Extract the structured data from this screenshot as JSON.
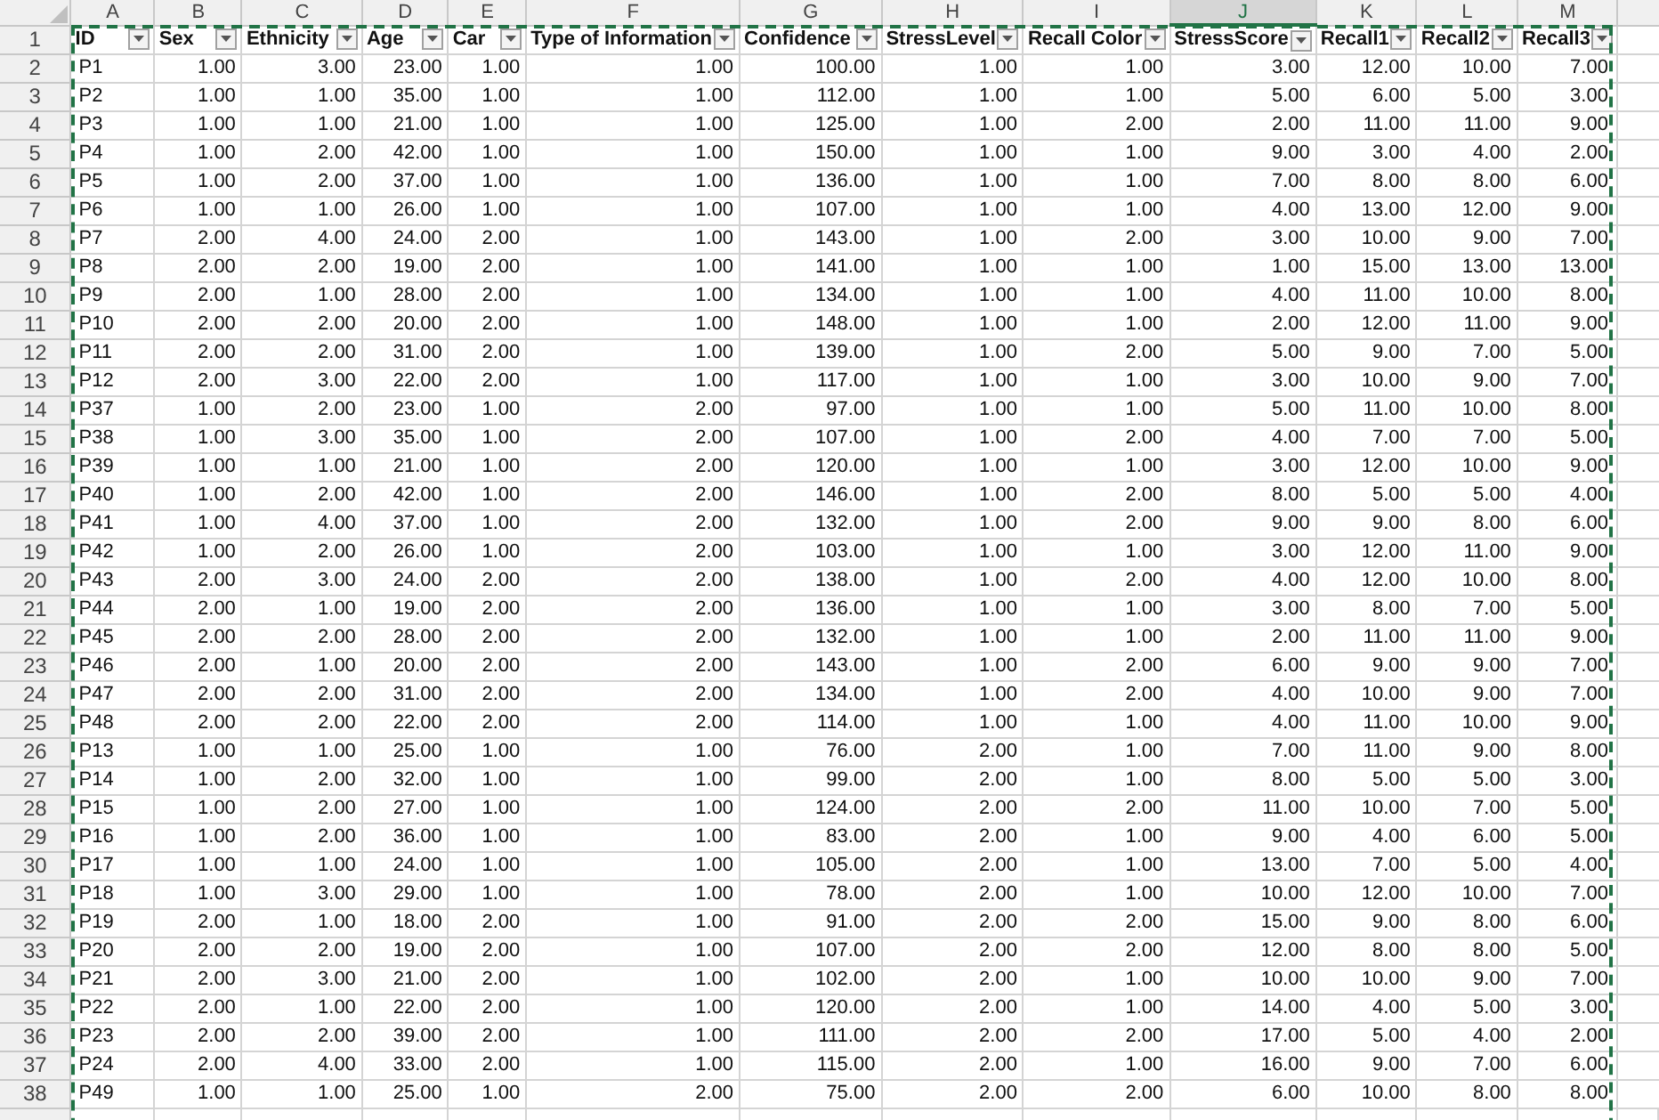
{
  "column_letters": [
    {
      "label": "A",
      "selected": false
    },
    {
      "label": "B",
      "selected": false
    },
    {
      "label": "C",
      "selected": false
    },
    {
      "label": "D",
      "selected": false
    },
    {
      "label": "E",
      "selected": false
    },
    {
      "label": "F",
      "selected": false
    },
    {
      "label": "G",
      "selected": false
    },
    {
      "label": "H",
      "selected": false
    },
    {
      "label": "I",
      "selected": false
    },
    {
      "label": "J",
      "selected": true
    },
    {
      "label": "K",
      "selected": false
    },
    {
      "label": "L",
      "selected": false
    },
    {
      "label": "M",
      "selected": false
    }
  ],
  "table": {
    "header_row_number": "1",
    "columns": [
      "ID",
      "Sex",
      "Ethnicity",
      "Age",
      "Car",
      "Type of Information",
      "Confidence",
      "StressLevel",
      "Recall Color",
      "StressScore",
      "Recall1",
      "Recall2",
      "Recall3"
    ],
    "rows": [
      {
        "row_number": "2",
        "cells": [
          "P1",
          "1.00",
          "3.00",
          "23.00",
          "1.00",
          "1.00",
          "100.00",
          "1.00",
          "1.00",
          "3.00",
          "12.00",
          "10.00",
          "7.00"
        ]
      },
      {
        "row_number": "3",
        "cells": [
          "P2",
          "1.00",
          "1.00",
          "35.00",
          "1.00",
          "1.00",
          "112.00",
          "1.00",
          "1.00",
          "5.00",
          "6.00",
          "5.00",
          "3.00"
        ]
      },
      {
        "row_number": "4",
        "cells": [
          "P3",
          "1.00",
          "1.00",
          "21.00",
          "1.00",
          "1.00",
          "125.00",
          "1.00",
          "2.00",
          "2.00",
          "11.00",
          "11.00",
          "9.00"
        ]
      },
      {
        "row_number": "5",
        "cells": [
          "P4",
          "1.00",
          "2.00",
          "42.00",
          "1.00",
          "1.00",
          "150.00",
          "1.00",
          "1.00",
          "9.00",
          "3.00",
          "4.00",
          "2.00"
        ]
      },
      {
        "row_number": "6",
        "cells": [
          "P5",
          "1.00",
          "2.00",
          "37.00",
          "1.00",
          "1.00",
          "136.00",
          "1.00",
          "1.00",
          "7.00",
          "8.00",
          "8.00",
          "6.00"
        ]
      },
      {
        "row_number": "7",
        "cells": [
          "P6",
          "1.00",
          "1.00",
          "26.00",
          "1.00",
          "1.00",
          "107.00",
          "1.00",
          "1.00",
          "4.00",
          "13.00",
          "12.00",
          "9.00"
        ]
      },
      {
        "row_number": "8",
        "cells": [
          "P7",
          "2.00",
          "4.00",
          "24.00",
          "2.00",
          "1.00",
          "143.00",
          "1.00",
          "2.00",
          "3.00",
          "10.00",
          "9.00",
          "7.00"
        ]
      },
      {
        "row_number": "9",
        "cells": [
          "P8",
          "2.00",
          "2.00",
          "19.00",
          "2.00",
          "1.00",
          "141.00",
          "1.00",
          "1.00",
          "1.00",
          "15.00",
          "13.00",
          "13.00"
        ]
      },
      {
        "row_number": "10",
        "cells": [
          "P9",
          "2.00",
          "1.00",
          "28.00",
          "2.00",
          "1.00",
          "134.00",
          "1.00",
          "1.00",
          "4.00",
          "11.00",
          "10.00",
          "8.00"
        ]
      },
      {
        "row_number": "11",
        "cells": [
          "P10",
          "2.00",
          "2.00",
          "20.00",
          "2.00",
          "1.00",
          "148.00",
          "1.00",
          "1.00",
          "2.00",
          "12.00",
          "11.00",
          "9.00"
        ]
      },
      {
        "row_number": "12",
        "cells": [
          "P11",
          "2.00",
          "2.00",
          "31.00",
          "2.00",
          "1.00",
          "139.00",
          "1.00",
          "2.00",
          "5.00",
          "9.00",
          "7.00",
          "5.00"
        ]
      },
      {
        "row_number": "13",
        "cells": [
          "P12",
          "2.00",
          "3.00",
          "22.00",
          "2.00",
          "1.00",
          "117.00",
          "1.00",
          "1.00",
          "3.00",
          "10.00",
          "9.00",
          "7.00"
        ]
      },
      {
        "row_number": "14",
        "cells": [
          "P37",
          "1.00",
          "2.00",
          "23.00",
          "1.00",
          "2.00",
          "97.00",
          "1.00",
          "1.00",
          "5.00",
          "11.00",
          "10.00",
          "8.00"
        ]
      },
      {
        "row_number": "15",
        "cells": [
          "P38",
          "1.00",
          "3.00",
          "35.00",
          "1.00",
          "2.00",
          "107.00",
          "1.00",
          "2.00",
          "4.00",
          "7.00",
          "7.00",
          "5.00"
        ]
      },
      {
        "row_number": "16",
        "cells": [
          "P39",
          "1.00",
          "1.00",
          "21.00",
          "1.00",
          "2.00",
          "120.00",
          "1.00",
          "1.00",
          "3.00",
          "12.00",
          "10.00",
          "9.00"
        ]
      },
      {
        "row_number": "17",
        "cells": [
          "P40",
          "1.00",
          "2.00",
          "42.00",
          "1.00",
          "2.00",
          "146.00",
          "1.00",
          "2.00",
          "8.00",
          "5.00",
          "5.00",
          "4.00"
        ]
      },
      {
        "row_number": "18",
        "cells": [
          "P41",
          "1.00",
          "4.00",
          "37.00",
          "1.00",
          "2.00",
          "132.00",
          "1.00",
          "2.00",
          "9.00",
          "9.00",
          "8.00",
          "6.00"
        ]
      },
      {
        "row_number": "19",
        "cells": [
          "P42",
          "1.00",
          "2.00",
          "26.00",
          "1.00",
          "2.00",
          "103.00",
          "1.00",
          "1.00",
          "3.00",
          "12.00",
          "11.00",
          "9.00"
        ]
      },
      {
        "row_number": "20",
        "cells": [
          "P43",
          "2.00",
          "3.00",
          "24.00",
          "2.00",
          "2.00",
          "138.00",
          "1.00",
          "2.00",
          "4.00",
          "12.00",
          "10.00",
          "8.00"
        ]
      },
      {
        "row_number": "21",
        "cells": [
          "P44",
          "2.00",
          "1.00",
          "19.00",
          "2.00",
          "2.00",
          "136.00",
          "1.00",
          "1.00",
          "3.00",
          "8.00",
          "7.00",
          "5.00"
        ]
      },
      {
        "row_number": "22",
        "cells": [
          "P45",
          "2.00",
          "2.00",
          "28.00",
          "2.00",
          "2.00",
          "132.00",
          "1.00",
          "1.00",
          "2.00",
          "11.00",
          "11.00",
          "9.00"
        ]
      },
      {
        "row_number": "23",
        "cells": [
          "P46",
          "2.00",
          "1.00",
          "20.00",
          "2.00",
          "2.00",
          "143.00",
          "1.00",
          "2.00",
          "6.00",
          "9.00",
          "9.00",
          "7.00"
        ]
      },
      {
        "row_number": "24",
        "cells": [
          "P47",
          "2.00",
          "2.00",
          "31.00",
          "2.00",
          "2.00",
          "134.00",
          "1.00",
          "2.00",
          "4.00",
          "10.00",
          "9.00",
          "7.00"
        ]
      },
      {
        "row_number": "25",
        "cells": [
          "P48",
          "2.00",
          "2.00",
          "22.00",
          "2.00",
          "2.00",
          "114.00",
          "1.00",
          "1.00",
          "4.00",
          "11.00",
          "10.00",
          "9.00"
        ]
      },
      {
        "row_number": "26",
        "cells": [
          "P13",
          "1.00",
          "1.00",
          "25.00",
          "1.00",
          "1.00",
          "76.00",
          "2.00",
          "1.00",
          "7.00",
          "11.00",
          "9.00",
          "8.00"
        ]
      },
      {
        "row_number": "27",
        "cells": [
          "P14",
          "1.00",
          "2.00",
          "32.00",
          "1.00",
          "1.00",
          "99.00",
          "2.00",
          "1.00",
          "8.00",
          "5.00",
          "5.00",
          "3.00"
        ]
      },
      {
        "row_number": "28",
        "cells": [
          "P15",
          "1.00",
          "2.00",
          "27.00",
          "1.00",
          "1.00",
          "124.00",
          "2.00",
          "2.00",
          "11.00",
          "10.00",
          "7.00",
          "5.00"
        ]
      },
      {
        "row_number": "29",
        "cells": [
          "P16",
          "1.00",
          "2.00",
          "36.00",
          "1.00",
          "1.00",
          "83.00",
          "2.00",
          "1.00",
          "9.00",
          "4.00",
          "6.00",
          "5.00"
        ]
      },
      {
        "row_number": "30",
        "cells": [
          "P17",
          "1.00",
          "1.00",
          "24.00",
          "1.00",
          "1.00",
          "105.00",
          "2.00",
          "1.00",
          "13.00",
          "7.00",
          "5.00",
          "4.00"
        ]
      },
      {
        "row_number": "31",
        "cells": [
          "P18",
          "1.00",
          "3.00",
          "29.00",
          "1.00",
          "1.00",
          "78.00",
          "2.00",
          "1.00",
          "10.00",
          "12.00",
          "10.00",
          "7.00"
        ]
      },
      {
        "row_number": "32",
        "cells": [
          "P19",
          "2.00",
          "1.00",
          "18.00",
          "2.00",
          "1.00",
          "91.00",
          "2.00",
          "2.00",
          "15.00",
          "9.00",
          "8.00",
          "6.00"
        ]
      },
      {
        "row_number": "33",
        "cells": [
          "P20",
          "2.00",
          "2.00",
          "19.00",
          "2.00",
          "1.00",
          "107.00",
          "2.00",
          "2.00",
          "12.00",
          "8.00",
          "8.00",
          "5.00"
        ]
      },
      {
        "row_number": "34",
        "cells": [
          "P21",
          "2.00",
          "3.00",
          "21.00",
          "2.00",
          "1.00",
          "102.00",
          "2.00",
          "1.00",
          "10.00",
          "10.00",
          "9.00",
          "7.00"
        ]
      },
      {
        "row_number": "35",
        "cells": [
          "P22",
          "2.00",
          "1.00",
          "22.00",
          "2.00",
          "1.00",
          "120.00",
          "2.00",
          "1.00",
          "14.00",
          "4.00",
          "5.00",
          "3.00"
        ]
      },
      {
        "row_number": "36",
        "cells": [
          "P23",
          "2.00",
          "2.00",
          "39.00",
          "2.00",
          "1.00",
          "111.00",
          "2.00",
          "2.00",
          "17.00",
          "5.00",
          "4.00",
          "2.00"
        ]
      },
      {
        "row_number": "37",
        "cells": [
          "P24",
          "2.00",
          "4.00",
          "33.00",
          "2.00",
          "1.00",
          "115.00",
          "2.00",
          "1.00",
          "16.00",
          "9.00",
          "7.00",
          "6.00"
        ]
      },
      {
        "row_number": "38",
        "cells": [
          "P49",
          "1.00",
          "1.00",
          "25.00",
          "1.00",
          "2.00",
          "75.00",
          "2.00",
          "2.00",
          "6.00",
          "10.00",
          "8.00",
          "8.00"
        ]
      }
    ]
  }
}
